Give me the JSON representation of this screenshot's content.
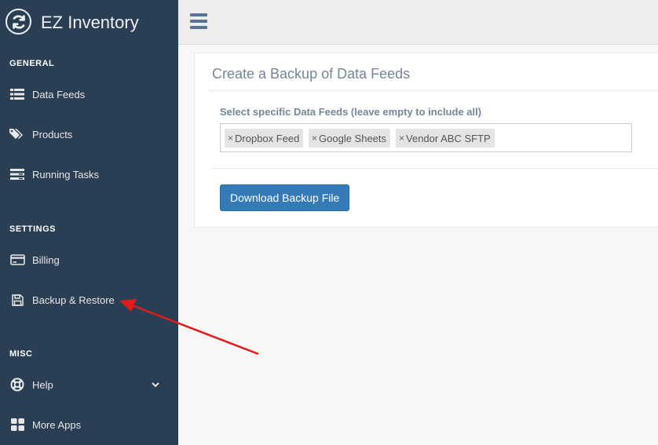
{
  "app": {
    "title": "EZ Inventory",
    "logo_icon": "sync-icon"
  },
  "sidebar": {
    "sections": [
      {
        "title": "GENERAL"
      },
      {
        "title": "SETTINGS"
      },
      {
        "title": "MISC"
      }
    ],
    "items": [
      {
        "label": "Data Feeds",
        "icon": "list-icon"
      },
      {
        "label": "Products",
        "icon": "tags-icon"
      },
      {
        "label": "Running Tasks",
        "icon": "tasks-icon"
      },
      {
        "label": "Billing",
        "icon": "credit-card-icon"
      },
      {
        "label": "Backup & Restore",
        "icon": "floppy-disk-icon"
      },
      {
        "label": "Help",
        "icon": "life-ring-icon",
        "has_dropdown": true
      },
      {
        "label": "More Apps",
        "icon": "grid-icon"
      }
    ],
    "bg_color": "#2a3f54"
  },
  "topbar": {
    "menu_icon": "hamburger-icon"
  },
  "panel": {
    "title": "Create a Backup of Data Feeds",
    "field_label": "Select specific Data Feeds (leave empty to include all)",
    "selected_feeds": [
      "Dropbox Feed",
      "Google Sheets",
      "Vendor ABC SFTP"
    ],
    "remove_symbol": "×",
    "button_label": "Download Backup File",
    "button_color": "#337ab7"
  },
  "annotation": {
    "type": "arrow",
    "color": "#e21b1b",
    "points_to": "Backup & Restore"
  }
}
